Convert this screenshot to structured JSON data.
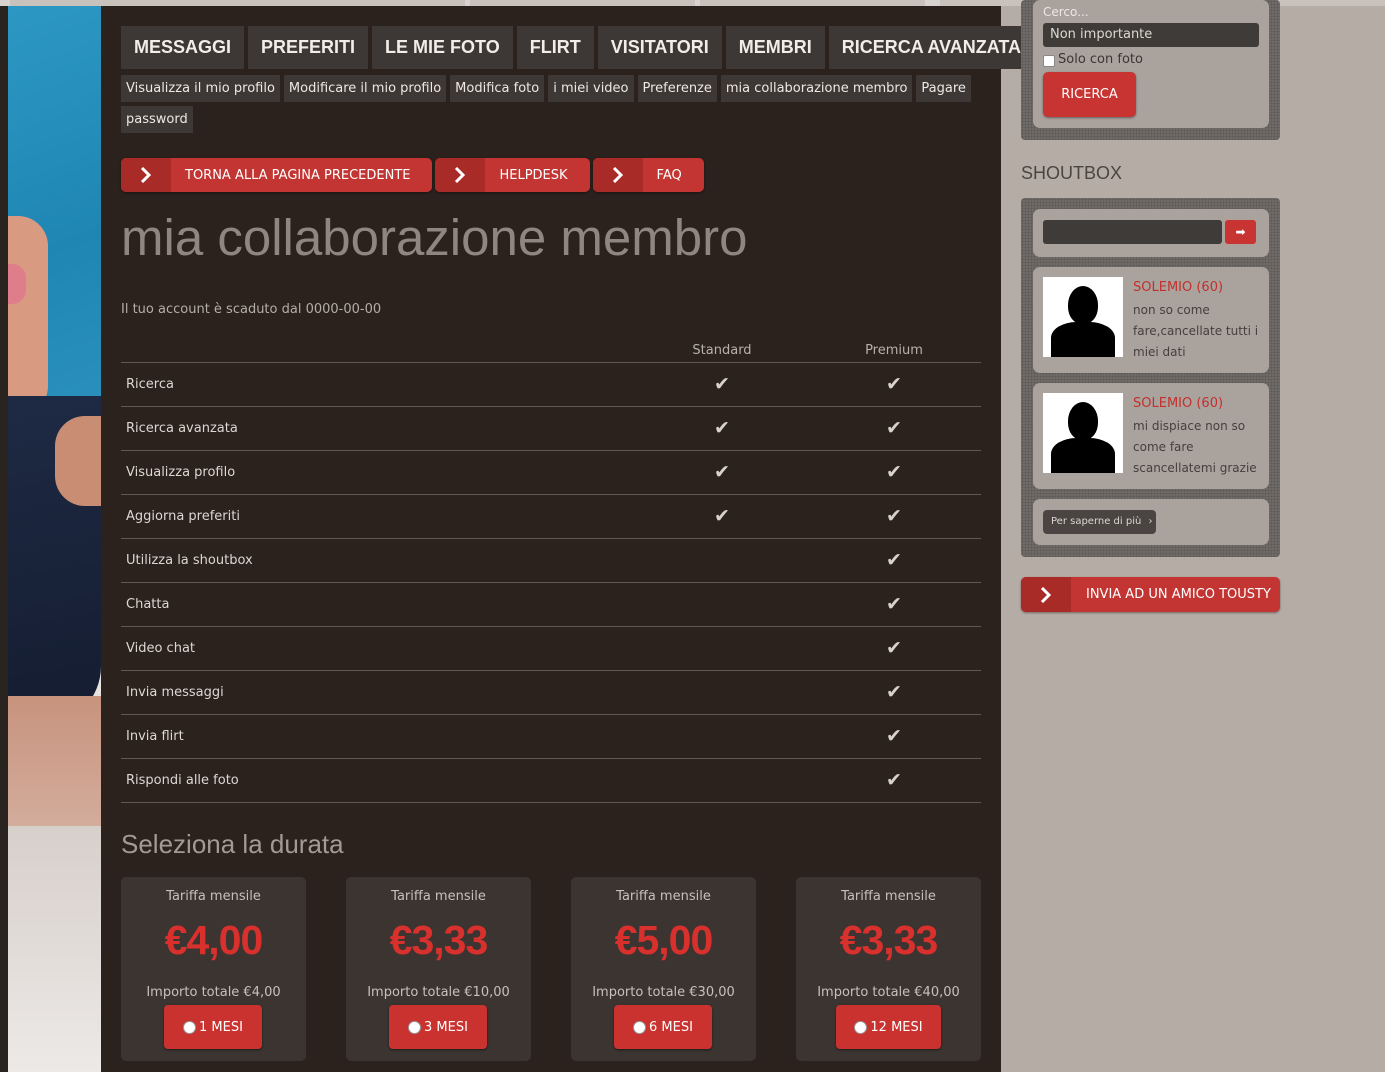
{
  "menu": [
    "MESSAGGI",
    "PREFERITI",
    "LE MIE FOTO",
    "FLIRT",
    "VISITATORI",
    "MEMBRI",
    "RICERCA AVANZATA"
  ],
  "submenu": [
    "Visualizza il mio profilo",
    "Modificare il mio profilo",
    "Modifica foto",
    "i miei video",
    "Preferenze",
    "mia collaborazione membro",
    "Pagare",
    "password"
  ],
  "actions": {
    "back": "TORNA ALLA PAGINA PRECEDENTE",
    "helpdesk": "HELPDESK",
    "faq": "FAQ"
  },
  "page": {
    "title": "mia collaborazione membro",
    "expired": "Il tuo account è scaduto dal 0000-00-00"
  },
  "table": {
    "col_standard": "Standard",
    "col_premium": "Premium",
    "check_glyph": "✔",
    "rows": [
      {
        "feature": "Ricerca",
        "standard": true,
        "premium": true
      },
      {
        "feature": "Ricerca avanzata",
        "standard": true,
        "premium": true
      },
      {
        "feature": "Visualizza profilo",
        "standard": true,
        "premium": true
      },
      {
        "feature": "Aggiorna preferiti",
        "standard": true,
        "premium": true
      },
      {
        "feature": "Utilizza la shoutbox",
        "standard": false,
        "premium": true
      },
      {
        "feature": "Chatta",
        "standard": false,
        "premium": true
      },
      {
        "feature": "Video chat",
        "standard": false,
        "premium": true
      },
      {
        "feature": "Invia messaggi",
        "standard": false,
        "premium": true
      },
      {
        "feature": "Invia flirt",
        "standard": false,
        "premium": true
      },
      {
        "feature": "Rispondi alle foto",
        "standard": false,
        "premium": true
      }
    ]
  },
  "duration": {
    "title": "Seleziona la durata",
    "plans": [
      {
        "monthly_label": "Tariffa mensile",
        "price": "€4,00",
        "total": "Importo totale €4,00",
        "button": "1 MESI"
      },
      {
        "monthly_label": "Tariffa mensile",
        "price": "€3,33",
        "total": "Importo totale €10,00",
        "button": "3 MESI"
      },
      {
        "monthly_label": "Tariffa mensile",
        "price": "€5,00",
        "total": "Importo totale €30,00",
        "button": "6 MESI"
      },
      {
        "monthly_label": "Tariffa mensile",
        "price": "€3,33",
        "total": "Importo totale €40,00",
        "button": "12 MESI"
      }
    ]
  },
  "sidebar": {
    "cerco_label": "Cerco...",
    "select_value": "Non importante",
    "photo_only_label": "Solo con foto",
    "search_button": "RICERCA",
    "shoutbox_title": "SHOUTBOX",
    "messages": [
      {
        "name": "SOLEMIO (60)",
        "text": "non so come fare,cancellate tutti i miei dati"
      },
      {
        "name": "SOLEMIO (60)",
        "text": "mi dispiace non so come fare scancellatemi grazie"
      }
    ],
    "more_button": "Per saperne di più",
    "invite_button": "INVIA AD UN AMICO TOUSTY"
  },
  "colors": {
    "accent_red": "#c33532",
    "panel_dark": "#2b211d",
    "price_red": "#d8312d"
  }
}
